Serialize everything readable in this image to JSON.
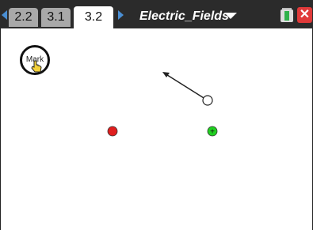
{
  "tabs": [
    {
      "label": "2.2",
      "active": false
    },
    {
      "label": "3.1",
      "active": false
    },
    {
      "label": "3.2",
      "active": true
    }
  ],
  "document_title": "Electric_Fields",
  "mark_button": {
    "label": "Mark"
  },
  "icons": {
    "nav_left": "triangle-left-icon",
    "nav_right": "triangle-right-icon",
    "doc_menu": "chevron-down-icon",
    "battery": "battery-icon",
    "close": "close-icon",
    "hand": "hand-pointer-icon"
  },
  "colors": {
    "negative_charge": "#e01e1e",
    "positive_charge": "#20d020",
    "accent": "#4a8fd4"
  },
  "charges": [
    {
      "type": "negative"
    },
    {
      "type": "positive",
      "symbol": "+"
    }
  ]
}
